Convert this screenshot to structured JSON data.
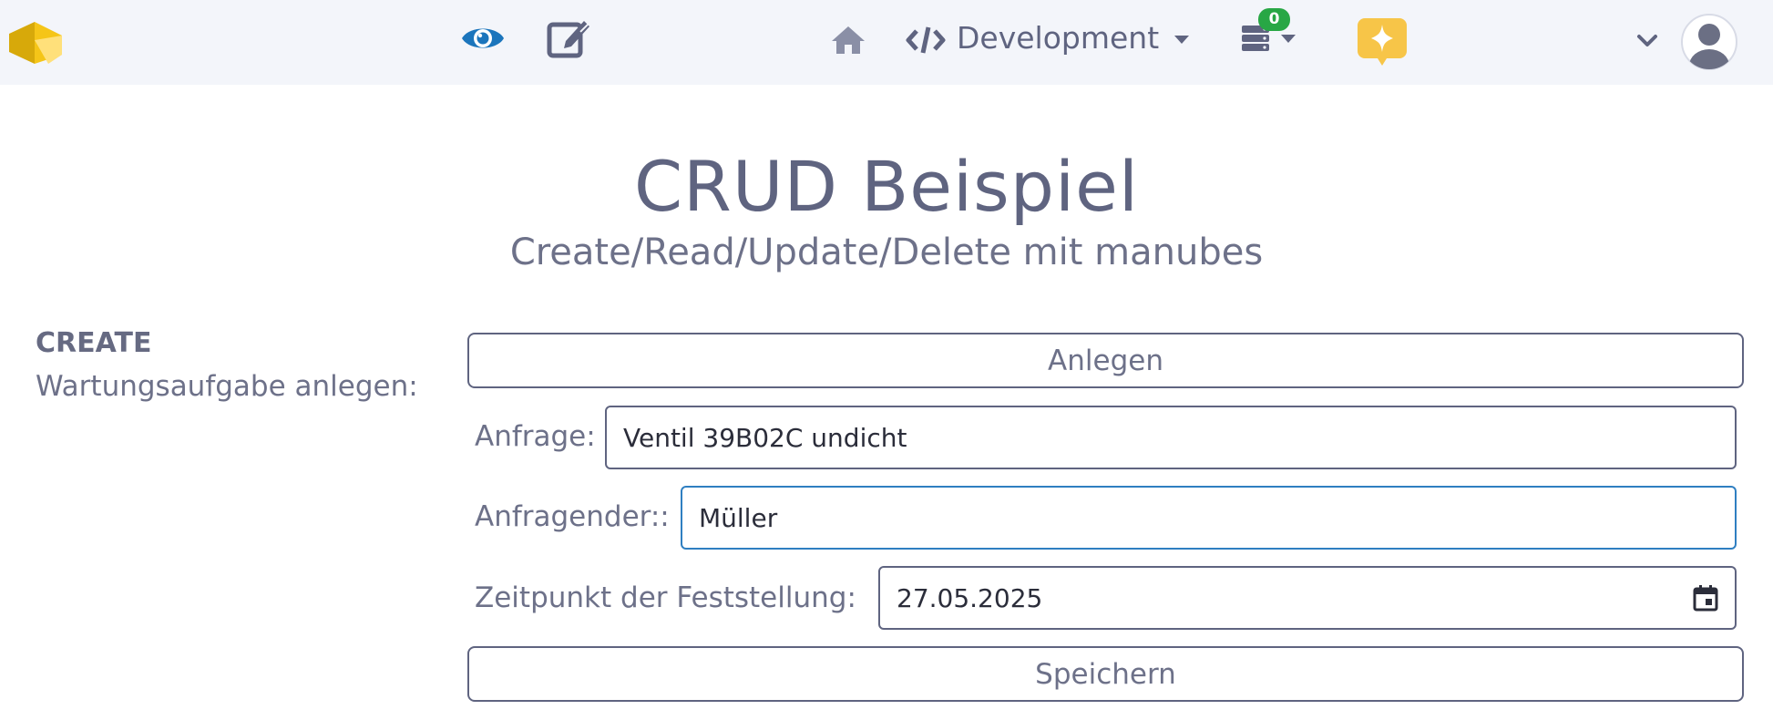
{
  "topbar": {
    "logo": "manubes-logo",
    "view_icon": "eye-icon",
    "edit_icon": "edit-icon",
    "home_icon": "home-icon",
    "environment": {
      "icon": "code-icon",
      "label": "Development"
    },
    "server_menu": {
      "icon": "server-icon",
      "badge": "0"
    },
    "assistant_icon": "sparkle-chat-icon",
    "user_menu": {
      "chevron": "chevron-down-icon",
      "avatar": "user-avatar-icon"
    }
  },
  "page": {
    "title": "CRUD Beispiel",
    "subtitle": "Create/Read/Update/Delete mit manubes"
  },
  "section": {
    "title": "CREATE",
    "description": "Wartungsaufgabe anlegen:"
  },
  "form": {
    "create_button": "Anlegen",
    "fields": [
      {
        "label": "Anfrage:",
        "value": "Ventil 39B02C undicht"
      },
      {
        "label": "Anfragender::",
        "value": "Müller"
      },
      {
        "label": "Zeitpunkt der Feststellung:",
        "value": "27.05.2025",
        "icon": "calendar-icon"
      }
    ],
    "save_button": "Speichern"
  },
  "colors": {
    "topbar_bg": "#f3f5fa",
    "text": "#5f6480",
    "accent_blue": "#1b75bc",
    "badge_green": "#28a745",
    "assistant_yellow": "#f7c548"
  }
}
